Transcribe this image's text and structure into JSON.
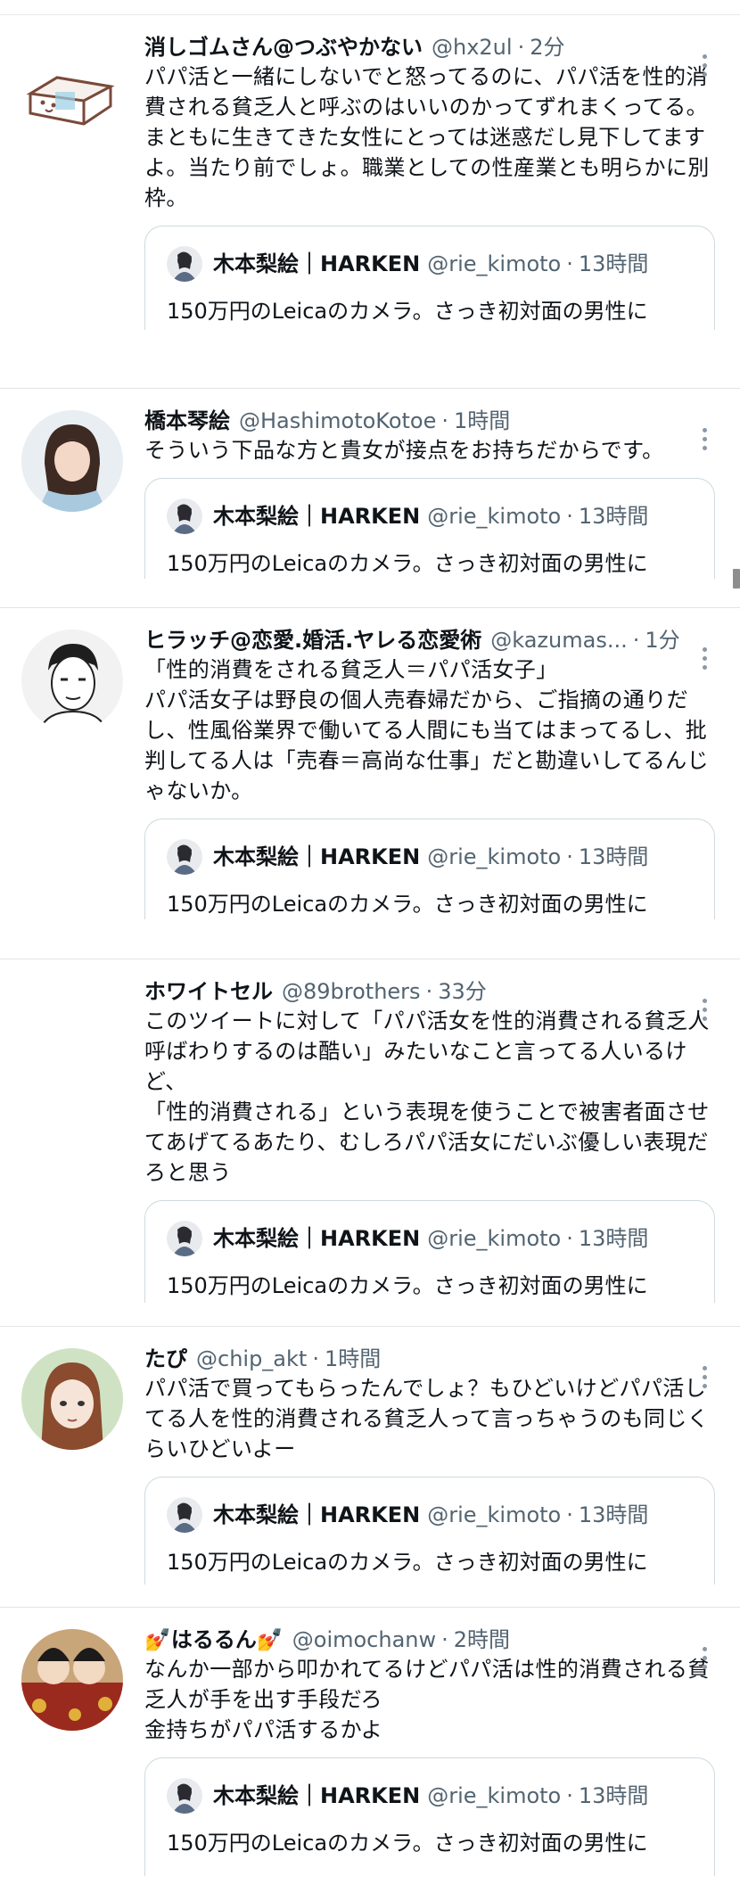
{
  "quoted": {
    "name": "木本梨絵｜HARKEN",
    "handle": "@rie_kimoto",
    "time": "13時間",
    "text": "150万円のLeicaのカメラ。さっき初対面の男性に"
  },
  "tweets": [
    {
      "name": "消しゴムさん@つぶやかない",
      "handle": "@hx2ul",
      "time": "2分",
      "text": "パパ活と一緒にしないでと怒ってるのに、パパ活を性的消費される貧乏人と呼ぶのはいいのかってずれまくってる。\nまともに生きてきた女性にとっては迷惑だし見下してますよ。当たり前でしょ。職業としての性産業とも明らかに別枠。"
    },
    {
      "name": "橋本琴絵",
      "handle": "@HashimotoKotoe",
      "time": "1時間",
      "text": "そういう下品な方と貴女が接点をお持ちだからです。"
    },
    {
      "name": "ヒラッチ@恋愛.婚活.ヤレる恋愛術",
      "handle": "@kazumas...",
      "time": "1分",
      "text": "「性的消費をされる貧乏人＝パパ活女子」\nパパ活女子は野良の個人売春婦だから、ご指摘の通りだし、性風俗業界で働いてる人間にも当てはまってるし、批判してる人は「売春＝高尚な仕事」だと勘違いしてるんじゃないか。"
    },
    {
      "name": "ホワイトセル",
      "handle": "@89brothers",
      "time": "33分",
      "text": "このツイートに対して「パパ活女を性的消費される貧乏人呼ばわりするのは酷い」みたいなこと言ってる人いるけど、\n「性的消費される」という表現を使うことで被害者面させてあげてるあたり、むしろパパ活女にだいぶ優しい表現だろと思う"
    },
    {
      "name": "たぴ",
      "handle": "@chip_akt",
      "time": "1時間",
      "text": "パパ活で買ってもらったんでしょ？もひどいけどパパ活してる人を性的消費される貧乏人って言っちゃうのも同じくらいひどいよー"
    },
    {
      "name": "💅はるるん💅",
      "handle": "@oimochanw",
      "time": "2時間",
      "text": "なんか一部から叩かれてるけどパパ活は性的消費される貧乏人が手を出す手段だろ\n金持ちがパパ活するかよ"
    }
  ]
}
